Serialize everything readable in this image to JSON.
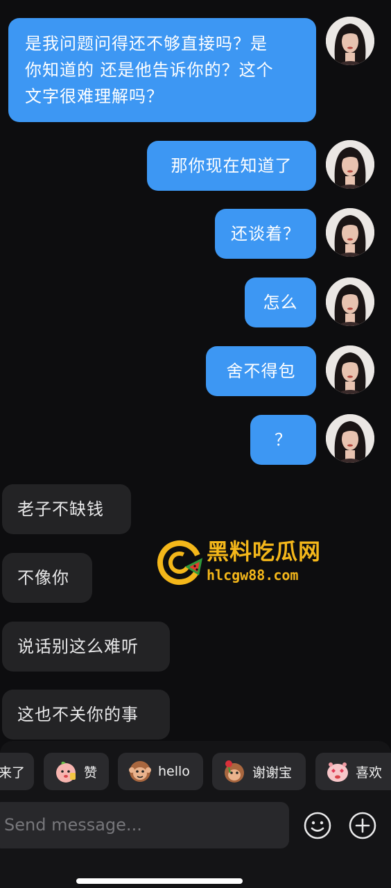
{
  "messages": {
    "outgoing": [
      {
        "text": "是我问题问得还不够直接吗？是你知道的 还是他告诉你的？这个文字很难理解吗？",
        "lines": [
          "是我问题问得还不够直接吗？是",
          "你知道的 还是他告诉你的？这个",
          "文字很难理解吗？"
        ]
      },
      {
        "text": "那你现在知道了"
      },
      {
        "text": "还谈着？"
      },
      {
        "text": "怎么"
      },
      {
        "text": "舍不得包"
      },
      {
        "text": "？"
      }
    ],
    "incoming": [
      {
        "text": "老子不缺钱"
      },
      {
        "text": "不像你"
      },
      {
        "text": "说话别这么难听"
      },
      {
        "text": "这也不关你的事"
      }
    ]
  },
  "watermark": {
    "title": "黑料吃瓜网",
    "url": "hlcgw88.com"
  },
  "quick_replies": [
    {
      "label": "来了",
      "icon": "emoji-face-icon"
    },
    {
      "label": "赞",
      "icon": "peach-thumbs-up-icon"
    },
    {
      "label": "hello",
      "icon": "monkey-wave-icon"
    },
    {
      "label": "谢谢宝",
      "icon": "monkey-rose-icon"
    },
    {
      "label": "喜欢",
      "icon": "pink-heart-eyes-icon"
    }
  ],
  "composer": {
    "placeholder": "Send message...",
    "emoji_button_icon": "smiley-icon",
    "add_button_icon": "plus-icon"
  },
  "colors": {
    "background": "#0d0d0f",
    "outgoing_bubble": "#3d97f3",
    "incoming_bubble": "#232325",
    "watermark_accent": "#f4b71a"
  }
}
